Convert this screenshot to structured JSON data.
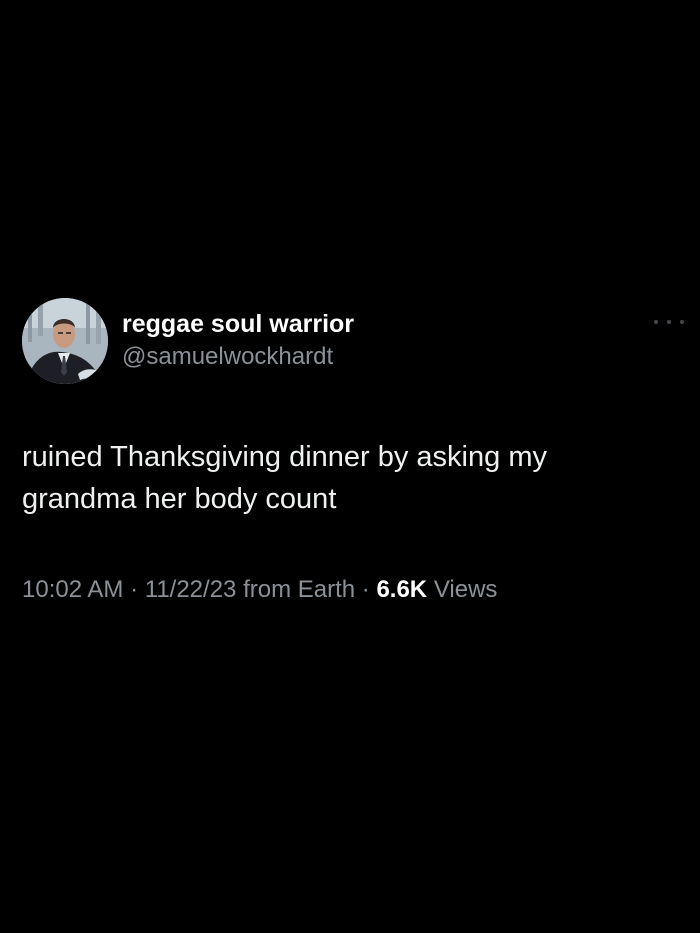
{
  "author": {
    "display_name": "reggae soul warrior",
    "handle": "@samuelwockhardt",
    "avatar_icon": "profile-photo"
  },
  "menu": {
    "icon": "more-options-icon"
  },
  "tweet": {
    "text": "ruined Thanksgiving dinner by asking my\ngrandma her body count"
  },
  "meta": {
    "time": "10:02 AM",
    "separator": "·",
    "date": "11/22/23",
    "source": "from Earth",
    "views_count": "6.6K",
    "views_label": "Views"
  },
  "colors": {
    "background": "#000000",
    "primary_text": "#ffffff",
    "secondary_text": "#8b9197"
  }
}
